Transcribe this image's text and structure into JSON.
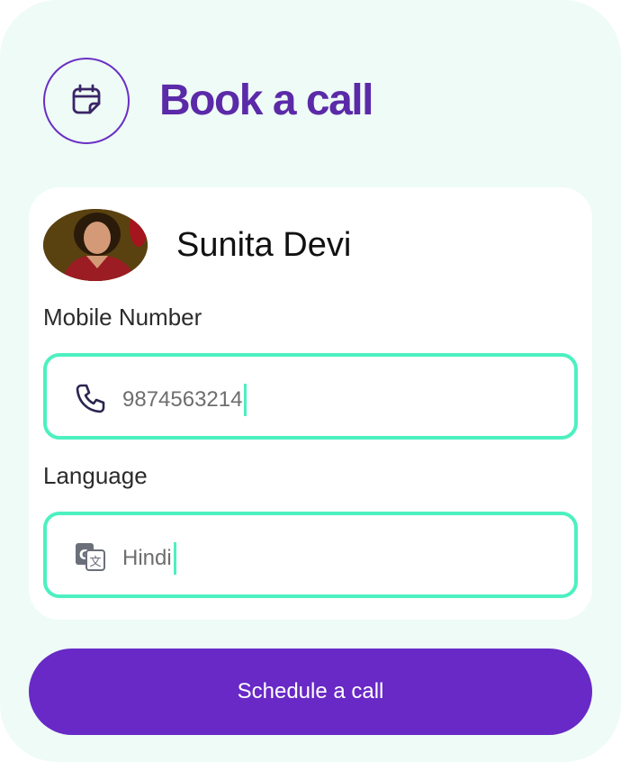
{
  "header": {
    "title": "Book a call",
    "icon": "calendar-icon"
  },
  "profile": {
    "name": "Sunita Devi",
    "avatar": "person-photo"
  },
  "form": {
    "mobile": {
      "label": "Mobile Number",
      "value": "9874563214",
      "icon": "phone-icon"
    },
    "language": {
      "label": "Language",
      "value": "Hindi",
      "icon": "translate-icon"
    }
  },
  "cta": {
    "label": "Schedule a call"
  },
  "colors": {
    "background": "#eefbf6",
    "accent": "#6829c6",
    "title": "#5b2aa8",
    "field_border": "#4df0c0"
  }
}
